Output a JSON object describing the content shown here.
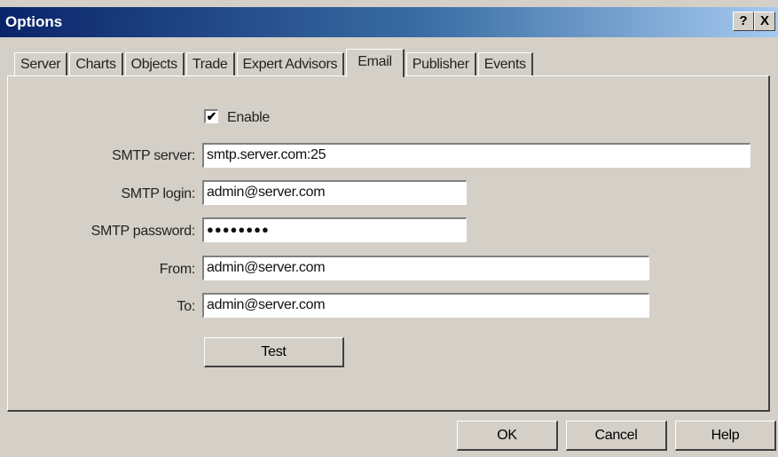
{
  "window": {
    "title": "Options",
    "help_button": "?",
    "close_button": "X"
  },
  "tabs": [
    {
      "label": "Server"
    },
    {
      "label": "Charts"
    },
    {
      "label": "Objects"
    },
    {
      "label": "Trade"
    },
    {
      "label": "Expert Advisors"
    },
    {
      "label": "Email",
      "active": true
    },
    {
      "label": "Publisher"
    },
    {
      "label": "Events"
    }
  ],
  "email": {
    "enable_label": "Enable",
    "enable_checked": "✔",
    "smtp_server_label": "SMTP server:",
    "smtp_server_value": "smtp.server.com:25",
    "smtp_login_label": "SMTP login:",
    "smtp_login_value": "admin@server.com",
    "smtp_password_label": "SMTP password:",
    "smtp_password_value": "●●●●●●●●",
    "from_label": "From:",
    "from_value": "admin@server.com",
    "to_label": "To:",
    "to_value": "admin@server.com",
    "test_button": "Test"
  },
  "footer": {
    "ok_button": "OK",
    "cancel_button": "Cancel",
    "help_button": "Help"
  }
}
